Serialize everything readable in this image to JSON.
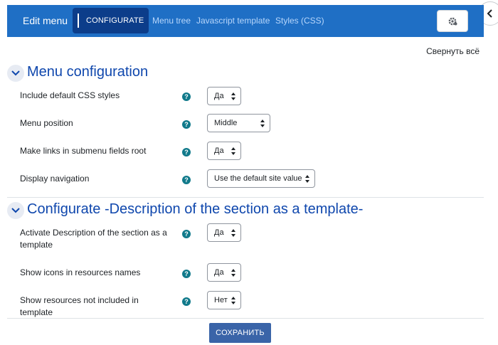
{
  "header": {
    "title": "Edit menu",
    "tabs": [
      {
        "label": "CONFIGURATE",
        "active": true
      },
      {
        "label": "Menu tree"
      },
      {
        "label": "Javascript template"
      },
      {
        "label": "Styles (CSS)"
      }
    ],
    "gear_icon": "gear-icon"
  },
  "collapse_all": "Свернуть всё",
  "sections": [
    {
      "title": "Menu configuration",
      "rows": [
        {
          "label": "Include default CSS styles",
          "value": "Да"
        },
        {
          "label": "Menu position",
          "value": "Middle"
        },
        {
          "label": "Make links in submenu fields root",
          "value": "Да"
        },
        {
          "label": "Display navigation",
          "value": "Use the default site value"
        }
      ]
    },
    {
      "title": "Configurate -Description of the section as a template-",
      "rows": [
        {
          "label": "Activate Description of the section as a template",
          "value": "Да"
        },
        {
          "label": "Show icons in resources names",
          "value": "Да"
        },
        {
          "label": "Show resources not included in template",
          "value": "Нет"
        }
      ]
    }
  ],
  "help_glyph": "?",
  "save_label": "СОХРАНИТЬ",
  "colors": {
    "header_bg": "#1f6fc5",
    "active_tab_bg": "#0c3d8a",
    "section_title": "#0f47ad",
    "help_icon": "#117a8b",
    "save_button": "#3a64a8"
  }
}
